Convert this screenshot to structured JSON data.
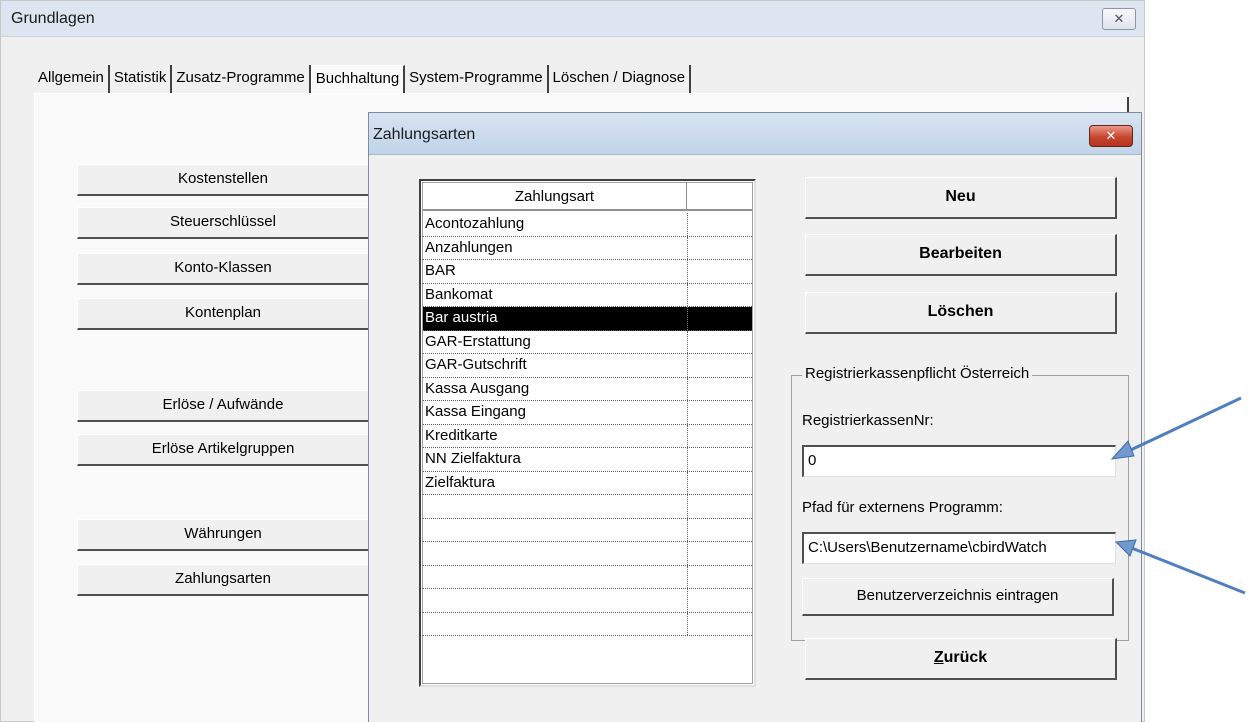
{
  "window": {
    "title": "Grundlagen",
    "close_glyph": "✕"
  },
  "tabs": [
    {
      "label": "Allgemein"
    },
    {
      "label": "Statistik"
    },
    {
      "label": "Zusatz-Programme"
    },
    {
      "label": "Buchhaltung"
    },
    {
      "label": "System-Programme"
    },
    {
      "label": "Löschen / Diagnose"
    }
  ],
  "active_tab": "Buchhaltung",
  "left_buttons": [
    {
      "label": "Kostenstellen"
    },
    {
      "label": "Steuerschlüssel"
    },
    {
      "label": "Konto-Klassen"
    },
    {
      "label": "Kontenplan"
    },
    {
      "label": "Erlöse / Aufwände"
    },
    {
      "label": "Erlöse Artikelgruppen"
    },
    {
      "label": "Währungen"
    },
    {
      "label": "Zahlungsarten"
    }
  ],
  "dialog": {
    "title": "Zahlungsarten",
    "close_glyph": "✕",
    "list": {
      "column_header": "Zahlungsart",
      "rows": [
        "Acontozahlung",
        "Anzahlungen",
        "BAR",
        "Bankomat",
        "Bar austria",
        "GAR-Erstattung",
        "GAR-Gutschrift",
        "Kassa Ausgang",
        "Kassa Eingang",
        "Kreditkarte",
        "NN Zielfaktura",
        "Zielfaktura"
      ],
      "selected": "Bar austria",
      "empty_rows": 6
    },
    "buttons": {
      "new": "Neu",
      "edit": "Bearbeiten",
      "delete": "Löschen",
      "back_underlined": "Z",
      "back_rest": "urück"
    },
    "group": {
      "legend": "Registrierkassenpflicht Österreich",
      "register_label": "RegistrierkassenNr:",
      "register_value": "0",
      "path_label": "Pfad für externens Programm:",
      "path_value": "C:\\Users\\Benutzername\\cbirdWatch",
      "userdir_button": "Benutzerverzeichnis eintragen"
    }
  },
  "colors": {
    "arrow": "#4f7fbf",
    "selected_row_bg": "#000000"
  }
}
